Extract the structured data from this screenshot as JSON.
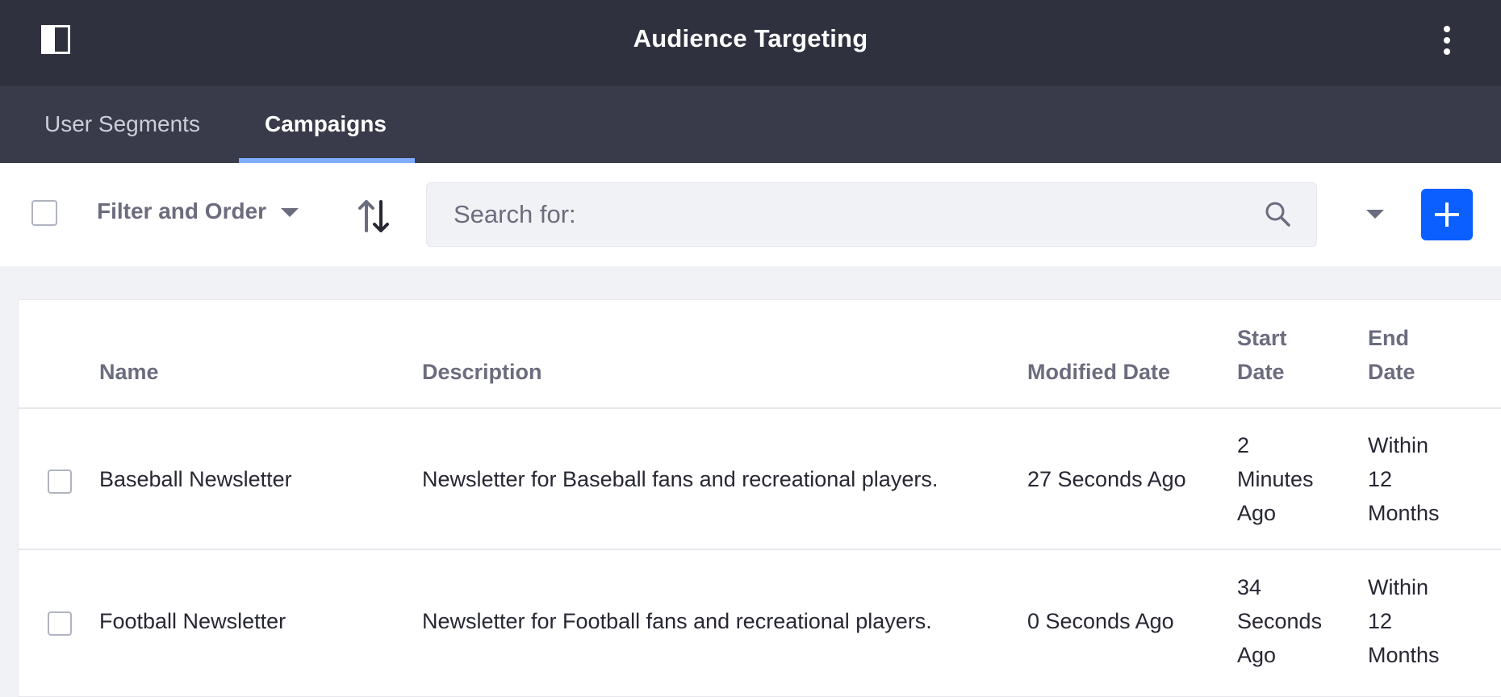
{
  "header": {
    "title": "Audience Targeting",
    "toggle_icon": "sidebar-toggle-icon",
    "menu_icon": "kebab-vertical-icon"
  },
  "tabs": [
    {
      "label": "User Segments",
      "active": false
    },
    {
      "label": "Campaigns",
      "active": true
    }
  ],
  "toolbar": {
    "filter_label": "Filter and Order",
    "search_placeholder": "Search for:",
    "accent_color": "#0b5fff"
  },
  "table": {
    "columns": {
      "name": "Name",
      "description": "Description",
      "modified": "Modified Date",
      "start_line1": "Start",
      "start_line2": "Date",
      "end_line1": "End",
      "end_line2": "Date"
    },
    "rows": [
      {
        "name": "Baseball Newsletter",
        "description": "Newsletter for Baseball fans and recreational players.",
        "modified": "27 Seconds Ago",
        "start": [
          "2",
          "Minutes",
          "Ago"
        ],
        "end": [
          "Within",
          "12",
          "Months"
        ]
      },
      {
        "name": "Football Newsletter",
        "description": "Newsletter for Football fans and recreational players.",
        "modified": "0 Seconds Ago",
        "start": [
          "34",
          "Seconds",
          "Ago"
        ],
        "end": [
          "Within",
          "12",
          "Months"
        ]
      }
    ]
  }
}
